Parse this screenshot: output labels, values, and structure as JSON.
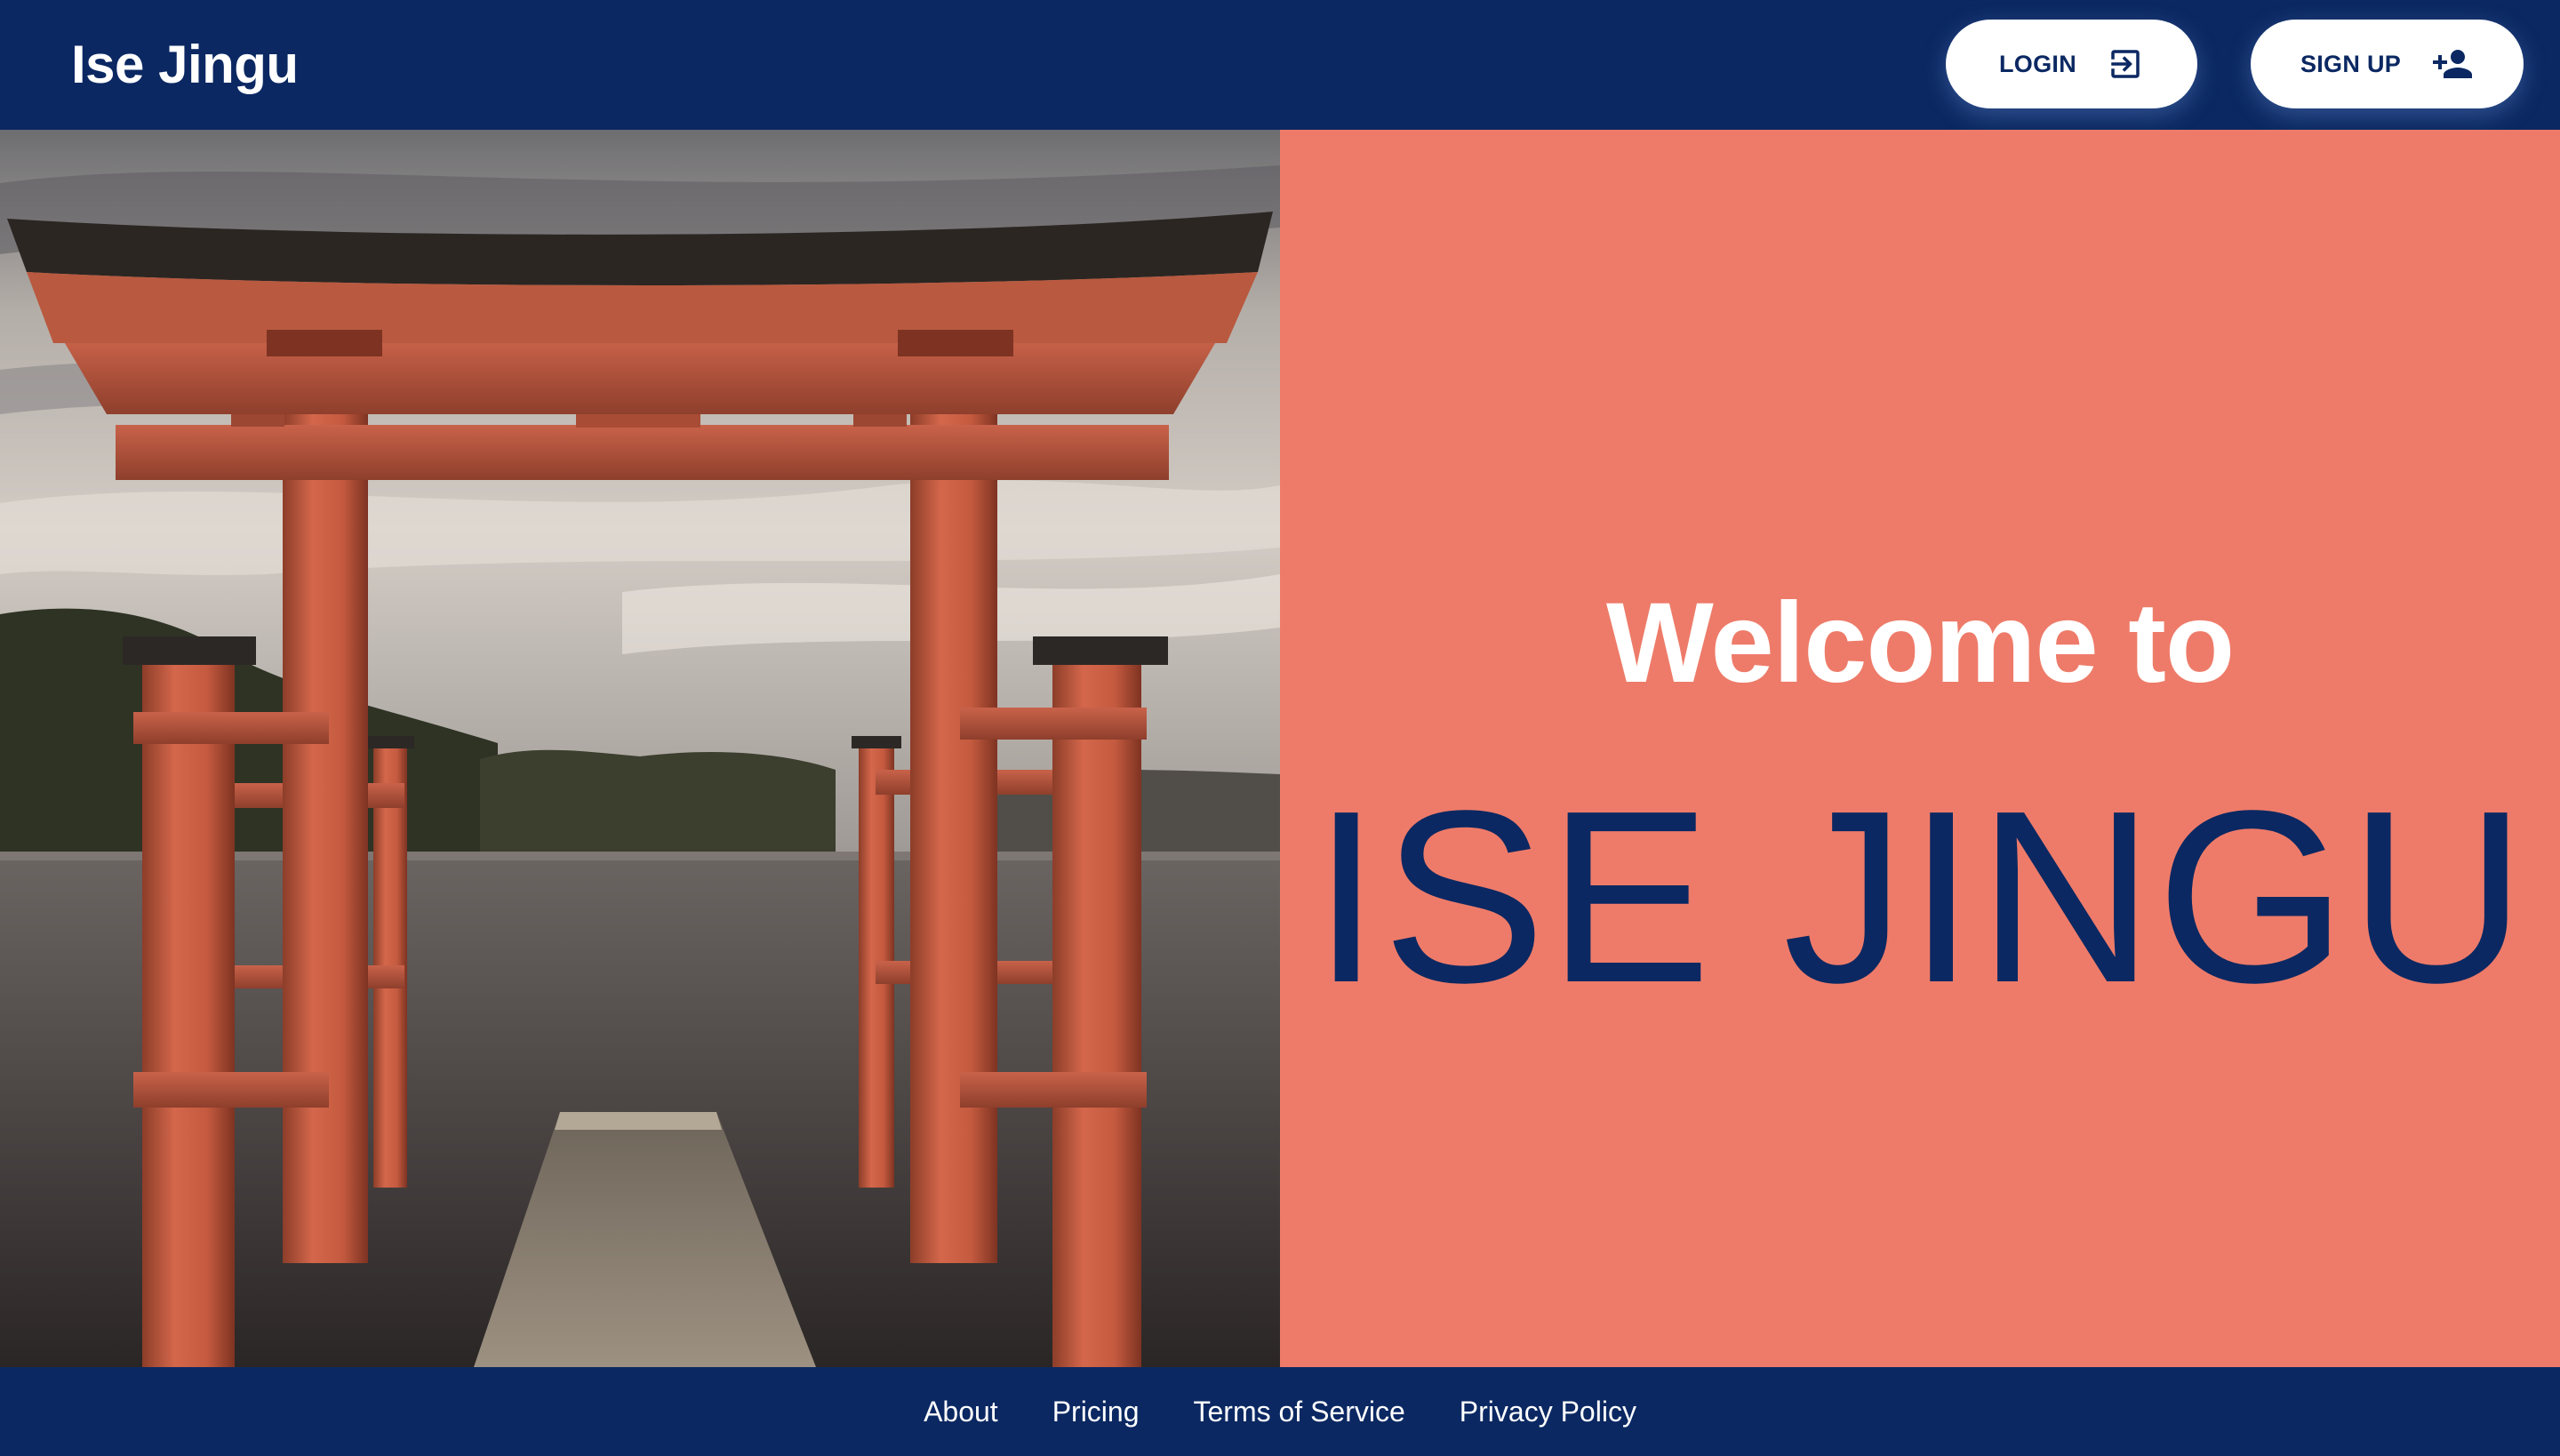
{
  "header": {
    "brand": "Ise Jingu",
    "login_label": "LOGIN",
    "login_icon": "login-icon",
    "signup_label": "SIGN UP",
    "signup_icon": "person-add-icon"
  },
  "hero": {
    "welcome": "Welcome to",
    "title": "ISE JINGU",
    "image_subject": "torii gate in lake",
    "panel_color": "#ee7b69"
  },
  "footer": {
    "links": [
      {
        "label": "About"
      },
      {
        "label": "Pricing"
      },
      {
        "label": "Terms of Service"
      },
      {
        "label": "Privacy Policy"
      }
    ]
  },
  "colors": {
    "navy": "#0b2862",
    "coral": "#ee7b69",
    "white": "#ffffff"
  }
}
